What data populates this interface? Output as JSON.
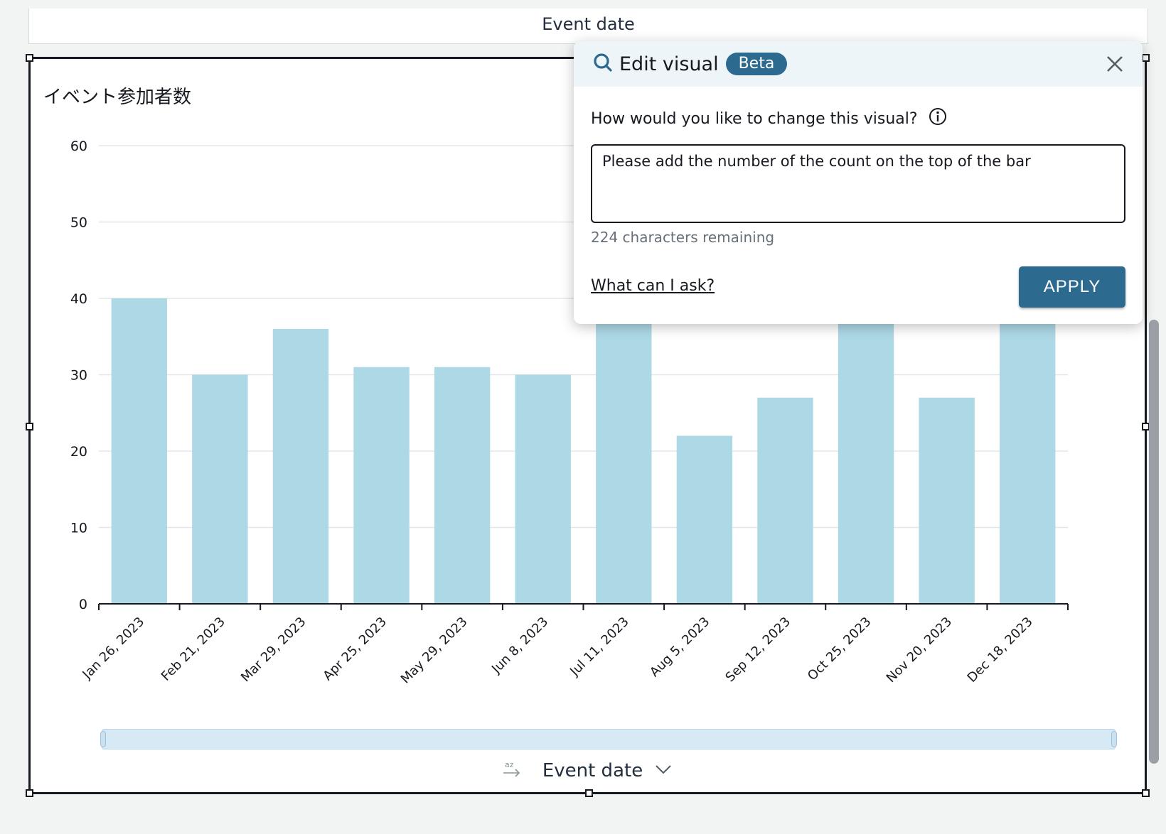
{
  "previous_visual": {
    "axis_title": "Event date"
  },
  "visual": {
    "title": "イベント参加者数",
    "x_axis_field": "Event date"
  },
  "colors": {
    "bar": "#add8e6",
    "accent": "#2d6a8f",
    "header_bg": "#eef5f9"
  },
  "chart_data": {
    "type": "bar",
    "title": "イベント参加者数",
    "xlabel": "Event date",
    "ylabel": "",
    "categories": [
      "Jan 26, 2023",
      "Feb 21, 2023",
      "Mar 29, 2023",
      "Apr 25, 2023",
      "May 29, 2023",
      "Jun 8, 2023",
      "Jul 11, 2023",
      "Aug 5, 2023",
      "Sep 12, 2023",
      "Oct 25, 2023",
      "Nov 20, 2023",
      "Dec 18, 2023"
    ],
    "values": [
      40,
      30,
      36,
      31,
      31,
      30,
      40,
      22,
      27,
      40,
      27,
      37
    ],
    "yticks": [
      0,
      10,
      20,
      30,
      40,
      50,
      60
    ],
    "ylim": [
      0,
      60
    ],
    "grid": true,
    "legend": "none"
  },
  "edit_popover": {
    "title": "Edit visual",
    "badge": "Beta",
    "question": "How would you like to change this visual?",
    "prompt_value": "Please add the number of the count on the top of the bar",
    "chars_remaining": "224 characters remaining",
    "help_link": "What can I ask?",
    "apply_label": "APPLY",
    "icons": {
      "title": "search-icon",
      "info": "info-icon",
      "close": "close-icon"
    }
  }
}
